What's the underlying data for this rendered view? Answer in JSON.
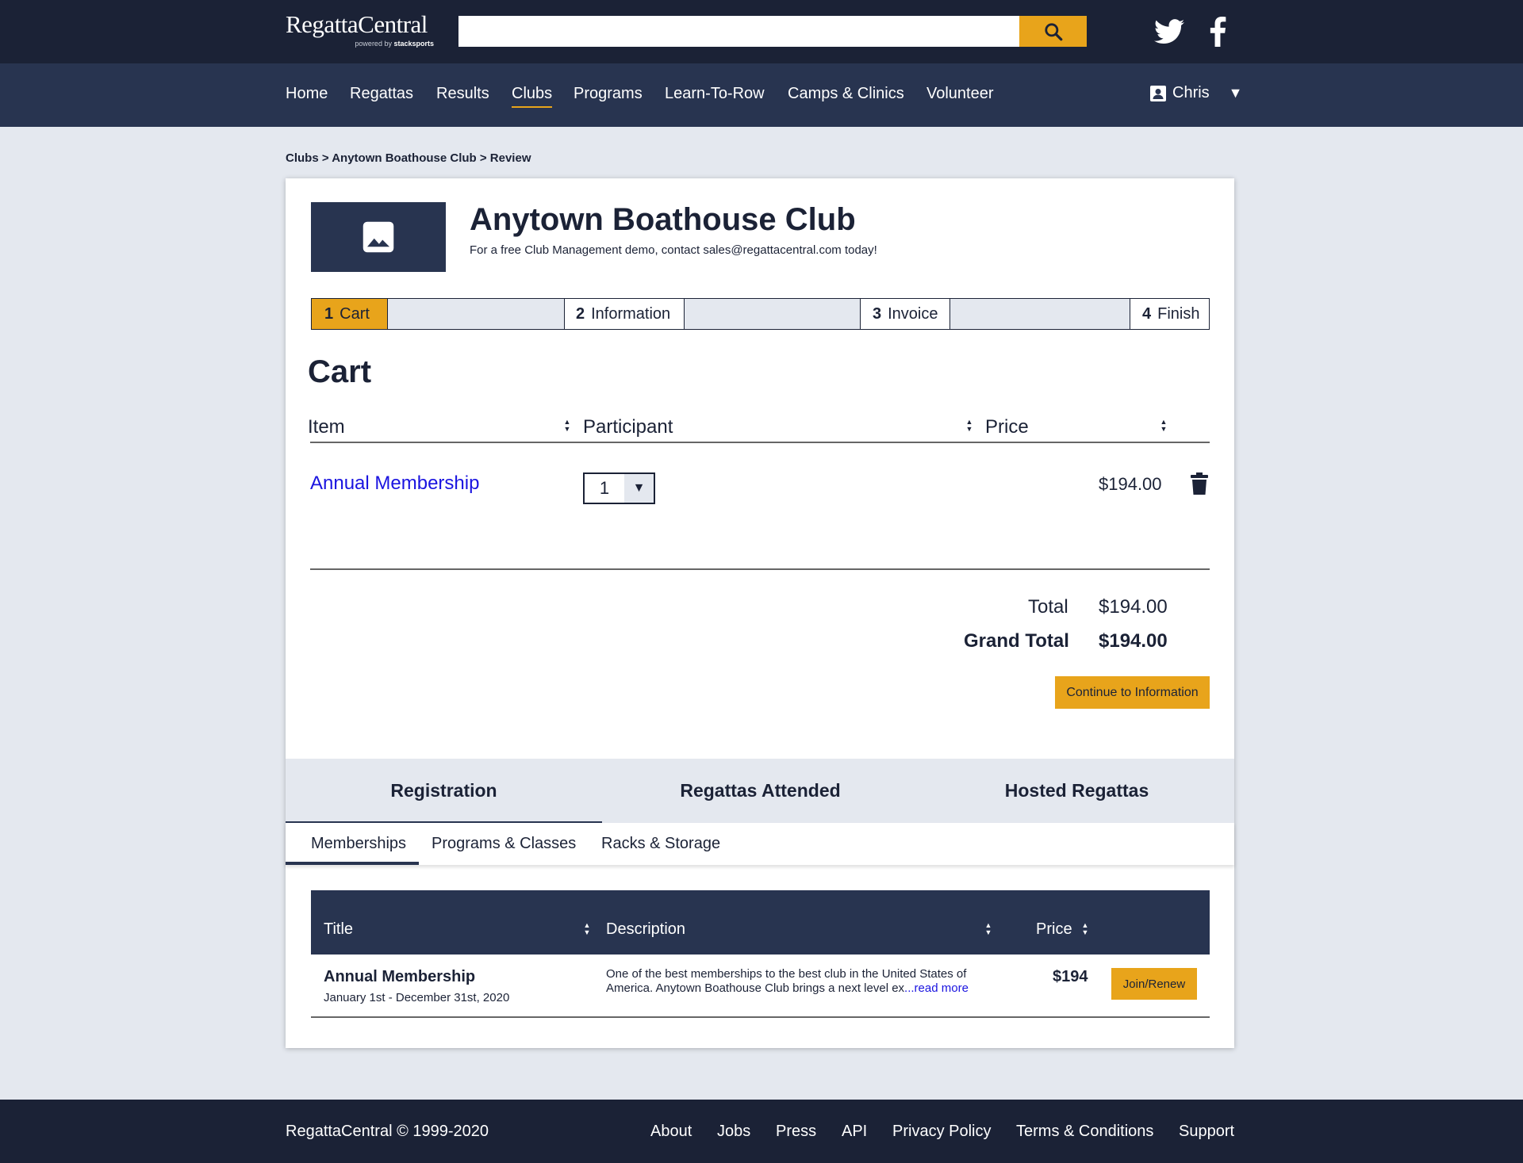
{
  "header": {
    "logo_text": "RegattaCentral",
    "logo_powered": "powered by",
    "logo_brand": "stacksports",
    "search": {
      "value": "",
      "placeholder": "",
      "icon": "search-icon"
    },
    "social": [
      "twitter-icon",
      "facebook-icon"
    ]
  },
  "nav": {
    "items": [
      {
        "label": "Home"
      },
      {
        "label": "Regattas"
      },
      {
        "label": "Results"
      },
      {
        "label": "Clubs",
        "active": true
      },
      {
        "label": "Programs"
      },
      {
        "label": "Learn-To-Row"
      },
      {
        "label": "Camps & Clinics"
      },
      {
        "label": "Volunteer"
      }
    ],
    "user": {
      "name": "Chris",
      "caret": "▼",
      "icon": "account-box-icon"
    }
  },
  "breadcrumb": "Clubs > Anytown Boathouse Club > Review",
  "club": {
    "name": "Anytown Boathouse Club",
    "subtitle": "For a free Club Management demo, contact sales@regattacentral.com today!",
    "image_icon": "image-placeholder-icon"
  },
  "steps": [
    {
      "num": "1",
      "label": "Cart",
      "active": true
    },
    {
      "num": "2",
      "label": "Information"
    },
    {
      "num": "3",
      "label": "Invoice"
    },
    {
      "num": "4",
      "label": "Finish"
    }
  ],
  "cart": {
    "title": "Cart",
    "columns": {
      "item": "Item",
      "participant": "Participant",
      "price": "Price"
    },
    "sort_icon": "▲▼",
    "items": [
      {
        "name": "Annual Membership",
        "quantity": "1",
        "quantity_caret": "▼",
        "price": "$194.00",
        "delete_icon": "trash-icon"
      }
    ],
    "total_label": "Total",
    "total_value": "$194.00",
    "grand_total_label": "Grand Total",
    "grand_total_value": "$194.00",
    "continue_label": "Continue to Information"
  },
  "tabs": {
    "main": [
      {
        "label": "Registration",
        "active": true
      },
      {
        "label": "Regattas Attended"
      },
      {
        "label": "Hosted Regattas"
      }
    ],
    "sub": [
      {
        "label": "Memberships",
        "active": true
      },
      {
        "label": "Programs & Classes"
      },
      {
        "label": "Racks & Storage"
      }
    ]
  },
  "memberships": {
    "columns": {
      "title": "Title",
      "description": "Description",
      "price": "Price"
    },
    "rows": [
      {
        "title": "Annual Membership",
        "dates": "January 1st - December 31st, 2020",
        "description": "One of the best memberships to the best club in the United States of America. Anytown Boathouse Club brings a next level ex",
        "read_more": "...read more",
        "price": "$194",
        "action": "Join/Renew"
      }
    ]
  },
  "footer": {
    "copyright": "RegattaCentral © 1999-2020",
    "links": [
      "About",
      "Jobs",
      "Press",
      "API",
      "Privacy Policy",
      "Terms & Conditions",
      "Support"
    ]
  },
  "colors": {
    "navy_dark": "#1b2236",
    "navy": "#283450",
    "accent": "#e8a41b",
    "page_bg": "#e4e8ef",
    "link": "#1a14e0"
  }
}
